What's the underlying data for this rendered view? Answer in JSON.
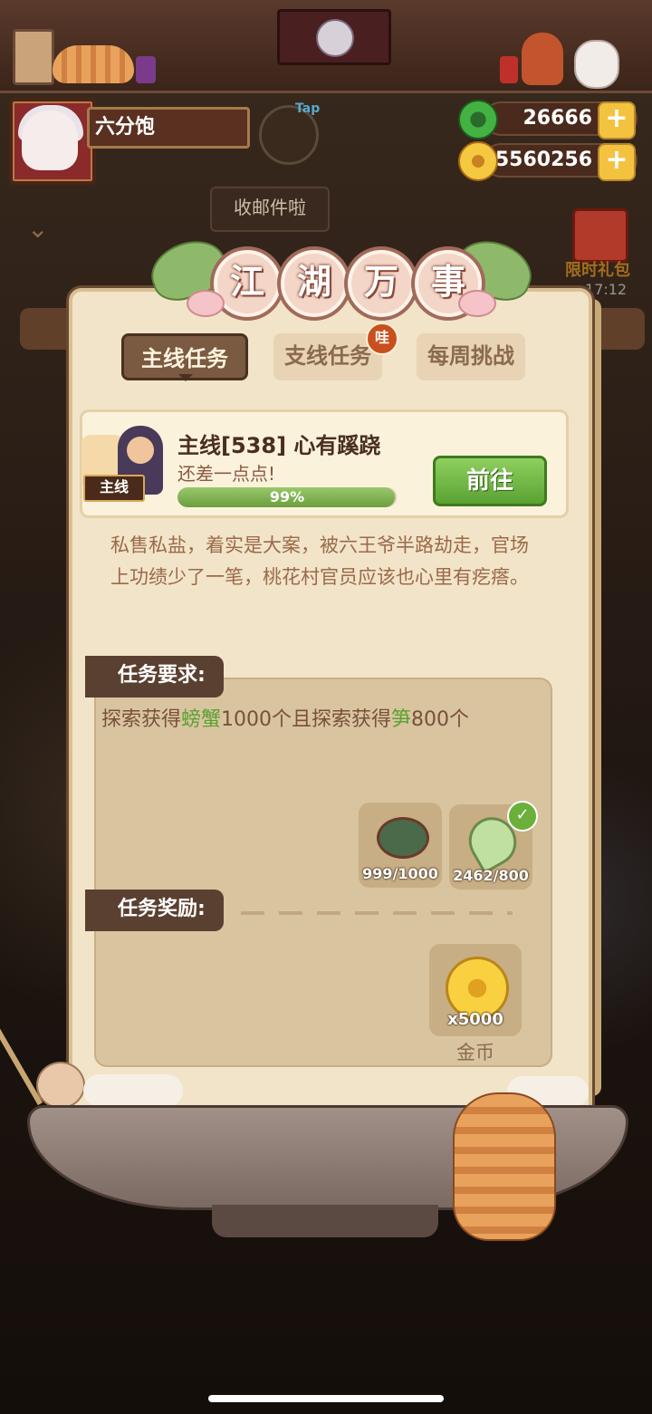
{
  "player": {
    "name": "六分饱",
    "tap_label": "Tap"
  },
  "resources": {
    "jade": {
      "value": "26666",
      "icon": "jade-icon"
    },
    "gold": {
      "value": "5560256",
      "icon": "gold-coin-icon"
    },
    "add_symbol": "+"
  },
  "mail_tip": "收邮件啦",
  "limited_gift": {
    "label": "限时礼包",
    "timer": "17:12"
  },
  "panel": {
    "title_chars": [
      "江",
      "湖",
      "万",
      "事"
    ],
    "tabs": [
      {
        "label": "主线任务",
        "active": true
      },
      {
        "label": "支线任务",
        "badge": "哇"
      },
      {
        "label": "每周挑战"
      }
    ],
    "quest": {
      "tag": "主线",
      "title": "主线[538] 心有蹊跷",
      "subtitle": "还差一点点!",
      "progress_percent": 99,
      "progress_label": "99%",
      "go_button": "前往"
    },
    "description": "私售私盐，着实是大案，被六王爷半路劫走，官场上功绩少了一笔，桃花村官员应该也心里有疙瘩。",
    "requirement": {
      "header": "任务要求:",
      "text_parts": [
        "探索获得",
        "螃蟹",
        "1000个且探索获得",
        "笋",
        "800个"
      ],
      "items": [
        {
          "icon": "crab-icon",
          "count": "999/1000",
          "done": false
        },
        {
          "icon": "bamboo-shoot-icon",
          "count": "2462/800",
          "done": true
        }
      ],
      "check_symbol": "✓"
    },
    "reward": {
      "header": "任务奖励:",
      "icon": "gold-coin-icon",
      "count": "x5000",
      "name": "金币"
    }
  },
  "colors": {
    "accent_green": "#5aa232",
    "panel_bg": "#f2e4c8",
    "tab_active": "#7a5a40"
  }
}
